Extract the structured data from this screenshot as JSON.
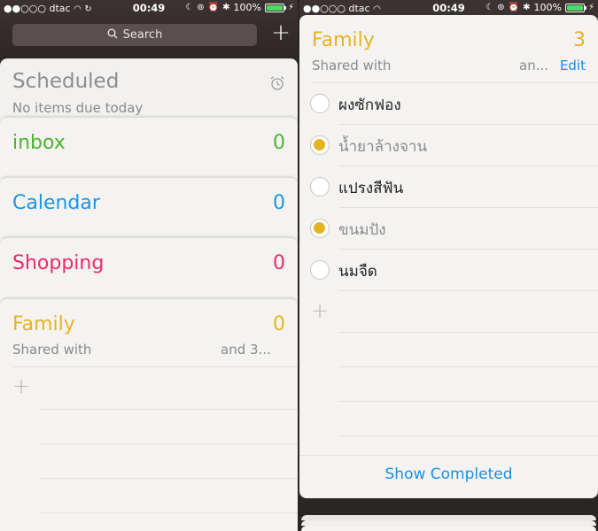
{
  "status_bar": {
    "carrier": "●●○○○ dtac",
    "time": "00:49",
    "battery": "100%"
  },
  "left": {
    "search_placeholder": "Search",
    "add_label": "+",
    "scheduled": {
      "title": "Scheduled",
      "subtitle": "No items due today"
    },
    "lists": [
      {
        "name": "inbox",
        "count": "0",
        "color": "#4cb52c"
      },
      {
        "name": "Calendar",
        "count": "0",
        "color": "#1a96e8"
      },
      {
        "name": "Shopping",
        "count": "0",
        "color": "#ee2a6b"
      }
    ],
    "family": {
      "name": "Family",
      "count": "0",
      "shared_with": "Shared with",
      "and_more": "and 3...",
      "color": "#e6b422"
    }
  },
  "right": {
    "family": {
      "name": "Family",
      "count": "3",
      "shared_with": "Shared with",
      "and_more": "an...",
      "edit": "Edit"
    },
    "items": [
      {
        "text": "ผงซักฟอง",
        "completed": false
      },
      {
        "text": "น้ำยาล้างจาน",
        "completed": true
      },
      {
        "text": "แปรงสีฟัน",
        "completed": false
      },
      {
        "text": "ขนมปัง",
        "completed": true
      },
      {
        "text": "นมจืด",
        "completed": false
      }
    ],
    "show_completed": "Show Completed"
  },
  "colors": {
    "accent": "#e6b422",
    "link": "#1a8fe3"
  }
}
